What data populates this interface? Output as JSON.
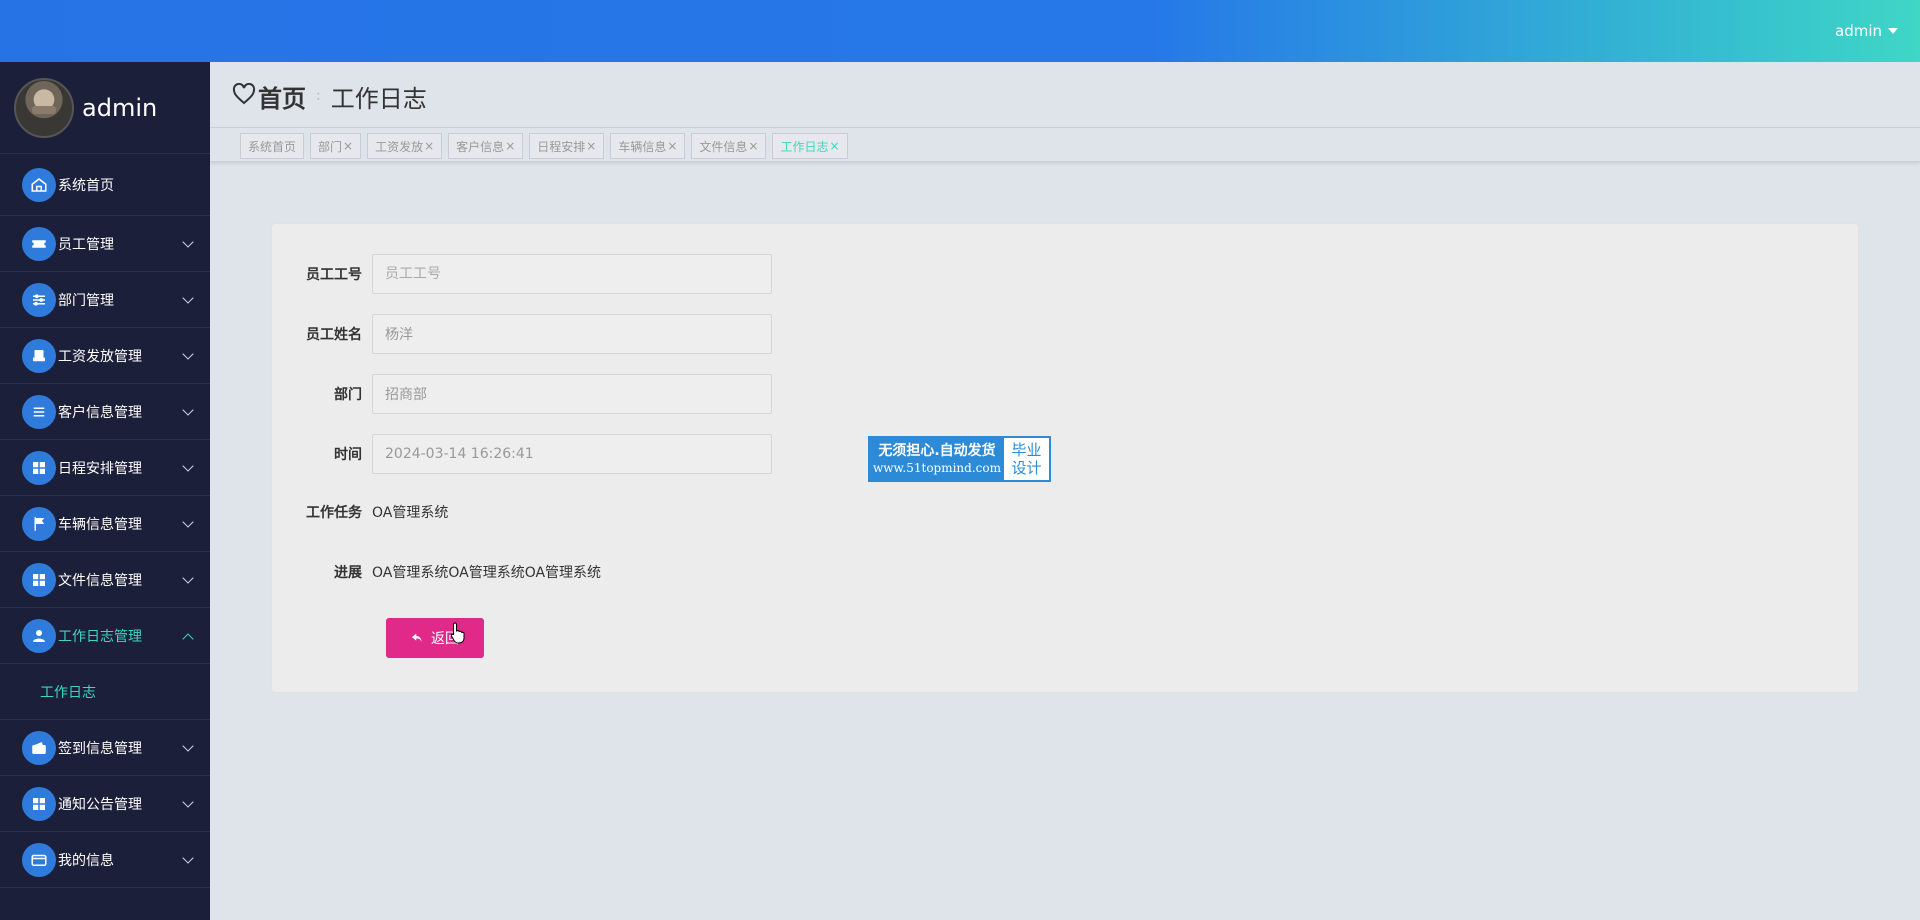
{
  "topbar": {
    "user": "admin"
  },
  "sidebar": {
    "username": "admin",
    "items": [
      {
        "label": "系统首页",
        "icon": "home-icon"
      },
      {
        "label": "员工管理",
        "icon": "ticket-icon"
      },
      {
        "label": "部门管理",
        "icon": "sliders-icon"
      },
      {
        "label": "工资发放管理",
        "icon": "printer-icon"
      },
      {
        "label": "客户信息管理",
        "icon": "list-icon"
      },
      {
        "label": "日程安排管理",
        "icon": "grid-icon"
      },
      {
        "label": "车辆信息管理",
        "icon": "flag-icon"
      },
      {
        "label": "文件信息管理",
        "icon": "grid-icon"
      },
      {
        "label": "工作日志管理",
        "icon": "user-icon"
      },
      {
        "label": "签到信息管理",
        "icon": "wallet-icon"
      },
      {
        "label": "通知公告管理",
        "icon": "grid-icon"
      },
      {
        "label": "我的信息",
        "icon": "card-icon"
      }
    ],
    "submenu": {
      "label": "工作日志"
    }
  },
  "breadcrumb": {
    "home": "首页",
    "separator": ":",
    "current": "工作日志"
  },
  "tabs": [
    {
      "label": "系统首页",
      "closable": false
    },
    {
      "label": "部门",
      "closable": true
    },
    {
      "label": "工资发放",
      "closable": true
    },
    {
      "label": "客户信息",
      "closable": true
    },
    {
      "label": "日程安排",
      "closable": true
    },
    {
      "label": "车辆信息",
      "closable": true
    },
    {
      "label": "文件信息",
      "closable": true
    },
    {
      "label": "工作日志",
      "closable": true,
      "active": true
    }
  ],
  "form": {
    "employee_no": {
      "label": "员工工号",
      "placeholder": "员工工号",
      "value": ""
    },
    "employee_name": {
      "label": "员工姓名",
      "value": "杨洋"
    },
    "department": {
      "label": "部门",
      "value": "招商部"
    },
    "time": {
      "label": "时间",
      "value": "2024-03-14 16:26:41"
    },
    "task": {
      "label": "工作任务",
      "value": "OA管理系统"
    },
    "progress": {
      "label": "进展",
      "value": "OA管理系统OA管理系统OA管理系统"
    },
    "back_button": "返回"
  },
  "badge": {
    "line1": "无须担心.自动发货",
    "line2": "www.51topmind.com",
    "side1": "毕业",
    "side2": "设计"
  },
  "colors": {
    "accent": "#3dd6c0",
    "primary": "#2f7bdc",
    "back_button": "#e12989",
    "sidebar": "#1c1f3a"
  }
}
